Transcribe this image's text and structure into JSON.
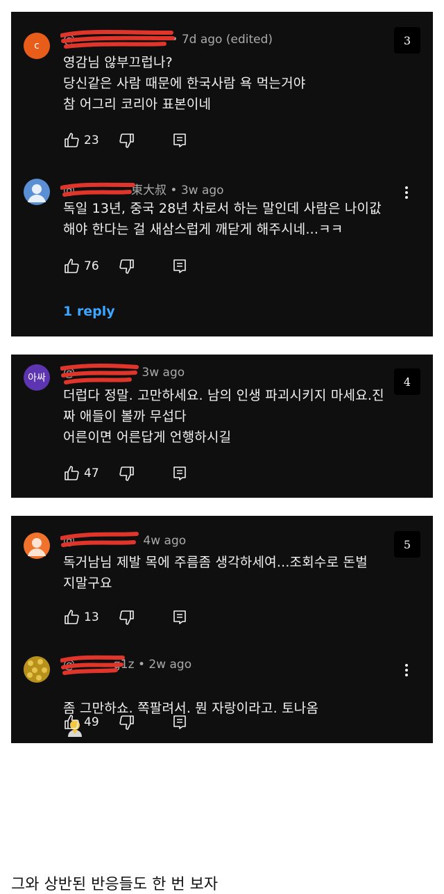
{
  "colors": {
    "card_bg": "#0f0f0f",
    "reply_blue": "#3ea6ff",
    "scribble_red": "#e0352b"
  },
  "cards": [
    {
      "badge": "3",
      "comments": [
        {
          "avatar_letter": "c",
          "avatar_color": "#e85d1a",
          "handle": "@",
          "time": "• 7d ago (edited)",
          "text": "영감님 않부끄럽나?\n당신같은 사람 때문에 한국사람 욕 먹는거야\n참 어그리 코리아 표본이네",
          "likes": "23"
        },
        {
          "avatar_letter": "",
          "avatar_color": "#5b8fd4",
          "handle": "@",
          "handle_tail": "東大叔",
          "time": "• 3w ago",
          "text": "독일 13년, 중국 28년 차로서 하는 말인데 사람은 나이값\n해야 한다는 걸 새삼스럽게 깨닫게 해주시네...ㅋㅋ",
          "likes": "76",
          "replies": "1 reply"
        }
      ]
    },
    {
      "badge": "4",
      "comments": [
        {
          "avatar_letter": "아싸",
          "avatar_color": "#5e35b1",
          "handle": "@",
          "time": "3w ago",
          "text": "더럽다 정말. 고만하세요. 남의 인생 파괴시키지 마세요.진\n짜 애들이 볼까 무섭다\n어른이면 어른답게 언행하시길",
          "likes": "47"
        }
      ]
    },
    {
      "badge": "5",
      "comments": [
        {
          "avatar_letter": "",
          "avatar_color": "#f0722c",
          "handle": "@",
          "time": "4w ago",
          "text": "독거남님 제발  목에 주름좀  생각하세여...조회수로 돈벌\n지말구요",
          "likes": "13"
        },
        {
          "avatar_letter": "",
          "avatar_color": "#c9a227",
          "handle": "@",
          "handle_tail": "g1z",
          "time": "• 2w ago",
          "text": "좀 그만하쇼. 쪽팔려서. 뭔 자랑이라고. 토나옴",
          "likes": "49"
        }
      ]
    }
  ],
  "caption": "그와 상반된 반응들도 한 번 보자"
}
